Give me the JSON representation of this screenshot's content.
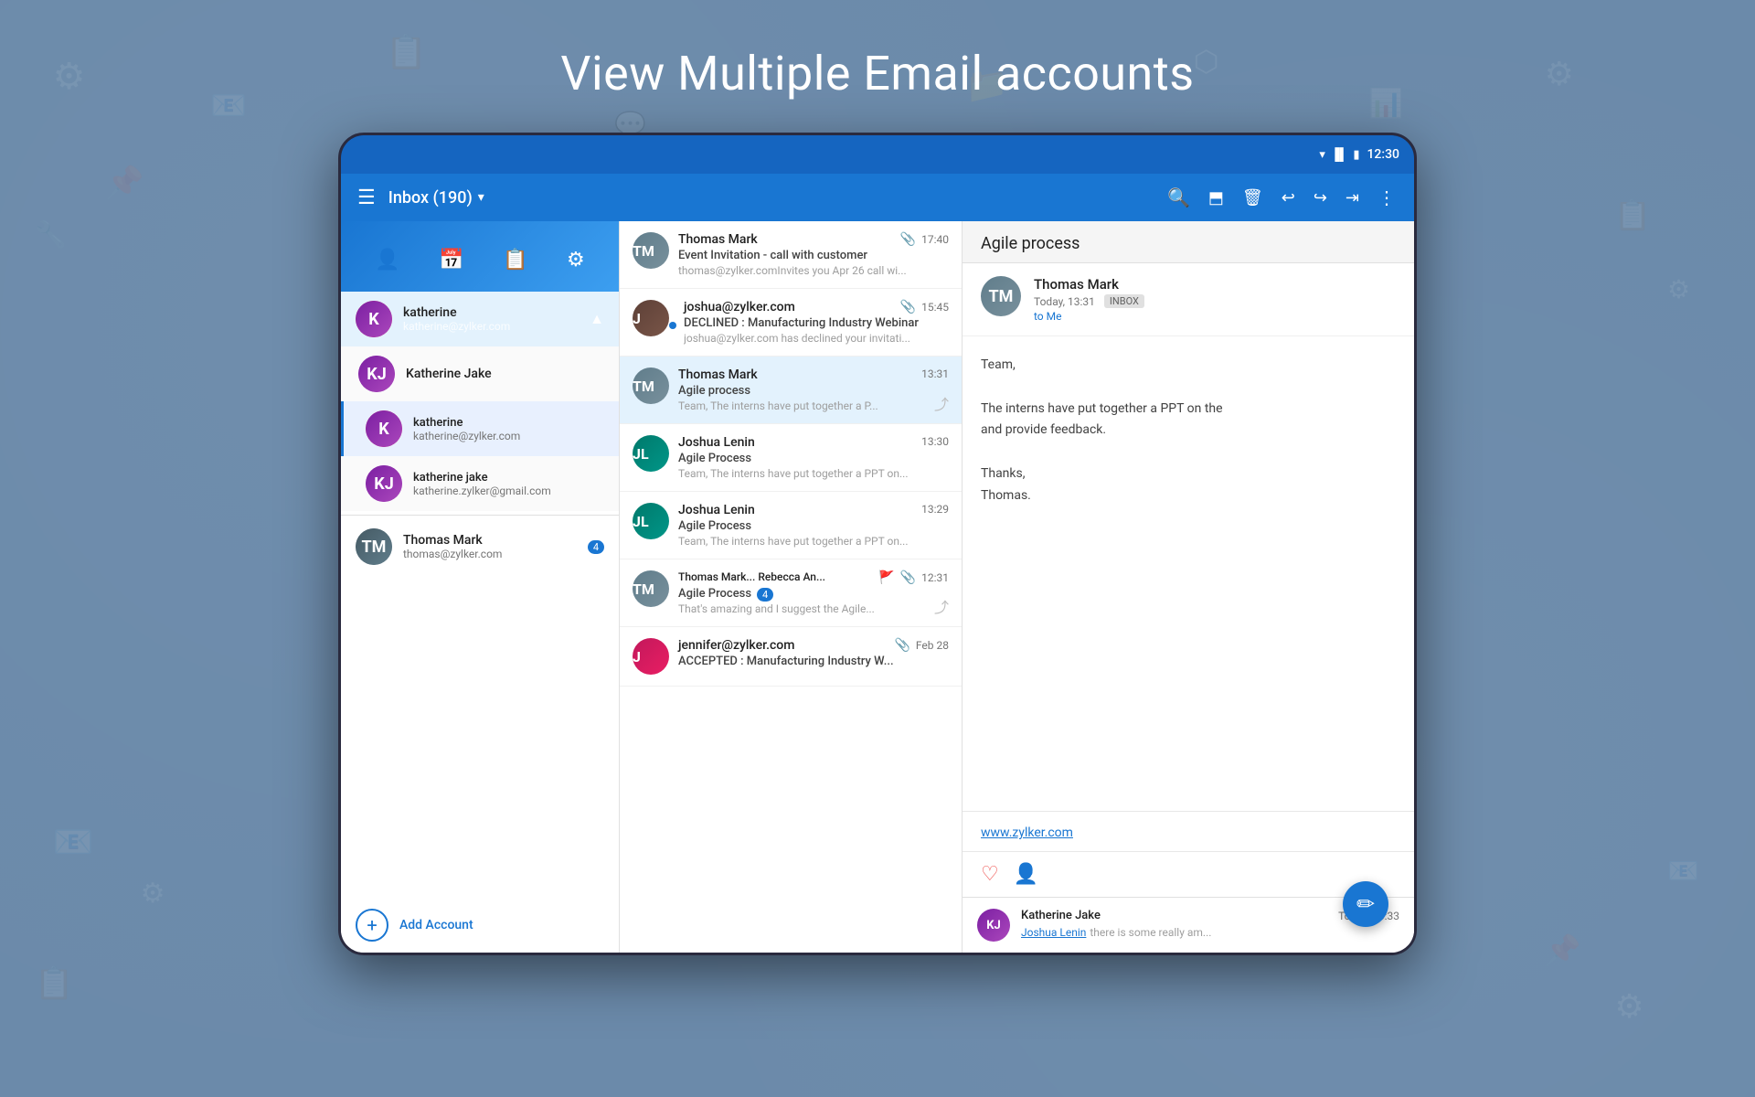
{
  "page": {
    "title": "View Multiple Email accounts",
    "background_color": "#6b8aaa"
  },
  "status_bar": {
    "time": "12:30",
    "wifi_icon": "▲",
    "signal_icon": "▐▐",
    "battery_icon": "▮"
  },
  "toolbar": {
    "menu_icon": "☰",
    "title": "Inbox (190)",
    "dropdown_icon": "▾",
    "search_icon": "🔍",
    "archive_icon": "⬒",
    "delete_icon": "🗑",
    "reply_icon": "↩",
    "reply_all_icon": "↩↩",
    "forward_icon": "→",
    "more_icon": "⋮"
  },
  "sidebar": {
    "nav_icons": [
      "👤",
      "📅",
      "📋",
      "⚙"
    ],
    "accounts": [
      {
        "id": "katherine-main",
        "name": "katherine",
        "email": "katherine@zylker.com",
        "avatar_type": "female-1",
        "avatar_letter": "K",
        "expanded": true,
        "expand_icon": "▲"
      }
    ],
    "sub_accounts": [
      {
        "id": "katherine-jake",
        "name": "Katherine Jake",
        "email": "",
        "avatar_type": "female-2",
        "avatar_letter": "KJ"
      },
      {
        "id": "katherine-sub1",
        "name": "katherine",
        "email": "katherine@zylker.com",
        "avatar_type": "female-1",
        "avatar_letter": "K"
      },
      {
        "id": "katherine-sub2",
        "name": "katherine jake",
        "email": "katherine.zylker@gmail.com",
        "avatar_type": "female-2",
        "avatar_letter": "KJ"
      }
    ],
    "other_accounts": [
      {
        "id": "thomas-mark",
        "name": "Thomas Mark",
        "email": "thomas@zylker.com",
        "avatar_type": "male-1",
        "avatar_letter": "TM",
        "badge_count": "4"
      }
    ],
    "add_account_label": "Add Account",
    "add_icon": "+"
  },
  "email_list": {
    "items": [
      {
        "id": "email-1",
        "sender": "Thomas Mark",
        "subject": "Event Invitation - call with customer",
        "preview": "thomas@zylker.comInvites you Apr 26 call wi...",
        "time": "17:40",
        "has_attachment": true,
        "avatar_type": "gray",
        "avatar_letter": "TM",
        "selected": false
      },
      {
        "id": "email-2",
        "sender": "joshua@zylker.com",
        "subject": "DECLINED : Manufacturing Industry Webinar",
        "preview": "joshua@zylker.com has declined your invitati...",
        "time": "15:45",
        "has_attachment": true,
        "avatar_type": "brown",
        "avatar_letter": "J",
        "selected": false
      },
      {
        "id": "email-3",
        "sender": "Thomas Mark",
        "subject": "Agile process",
        "preview": "Team, The interns have put together a P...",
        "time": "13:31",
        "has_attachment": false,
        "has_share": true,
        "avatar_type": "gray",
        "avatar_letter": "TM",
        "selected": true
      },
      {
        "id": "email-4",
        "sender": "Joshua Lenin",
        "subject": "Agile Process",
        "preview": "Team, The interns have put together a PPT on...",
        "time": "13:30",
        "has_attachment": false,
        "avatar_type": "teal",
        "avatar_letter": "JL",
        "selected": false
      },
      {
        "id": "email-5",
        "sender": "Joshua Lenin",
        "subject": "Agile Process",
        "preview": "Team, The interns have put together a PPT on...",
        "time": "13:29",
        "has_attachment": false,
        "avatar_type": "teal",
        "avatar_letter": "JL",
        "selected": false
      },
      {
        "id": "email-6",
        "sender": "Thomas Mark... Rebecca An...",
        "subject": "Agile Process",
        "preview": "That's amazing and I suggest the Agile...",
        "time": "12:31",
        "has_attachment": true,
        "has_flag": true,
        "has_share": true,
        "badge_count": "4",
        "avatar_type": "gray",
        "avatar_letter": "TM",
        "selected": false
      },
      {
        "id": "email-7",
        "sender": "jennifer@zylker.com",
        "subject": "ACCEPTED : Manufacturing Industry W...",
        "preview": "",
        "time": "Feb 28",
        "has_attachment": true,
        "avatar_type": "pink",
        "avatar_letter": "J",
        "selected": false
      }
    ]
  },
  "email_detail": {
    "subject": "Agile process",
    "sender": {
      "name": "Thomas Mark",
      "avatar_letter": "TM",
      "date": "Today, 13:31",
      "folder": "INBOX",
      "to": "to Me"
    },
    "body_lines": [
      "Team,",
      "",
      "The interns have put together a PPT on the",
      "and provide feedback.",
      "",
      "Thanks,",
      "Thomas."
    ],
    "link": "www.zylker.com",
    "reply_section": {
      "avatar_letter": "KJ",
      "name": "Katherine Jake",
      "date": "Today, 13:33",
      "link_text": "Joshua Lenin",
      "link_suffix": " there is some really am..."
    },
    "actions": {
      "like_icon": "♡",
      "add_person_icon": "👤+"
    }
  },
  "fab": {
    "icon": "✏"
  }
}
